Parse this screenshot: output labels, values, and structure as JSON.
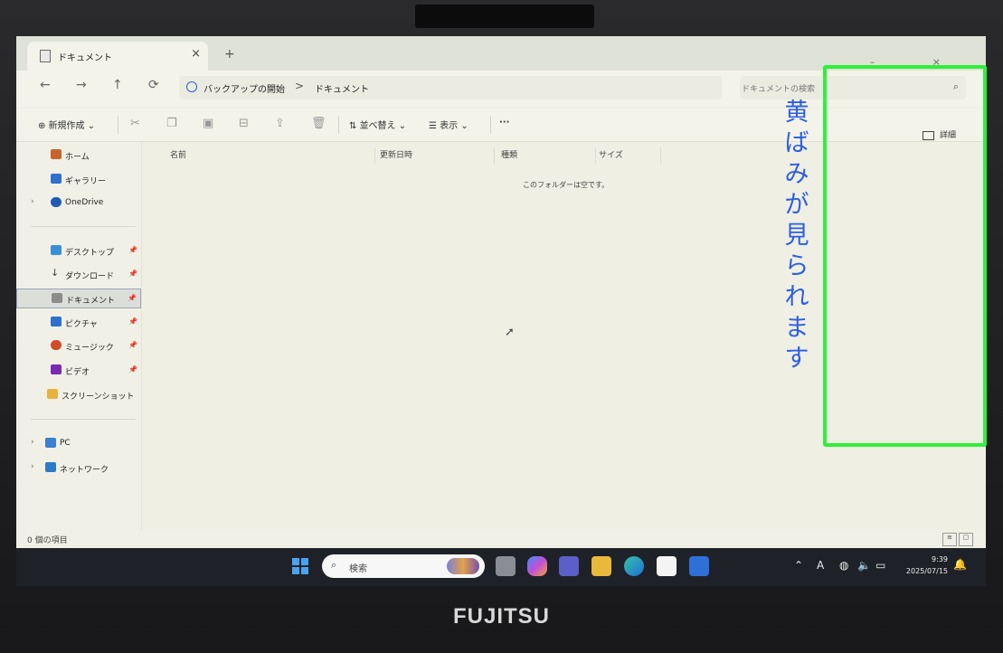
{
  "tab": {
    "title": "ドキュメント",
    "close": "×",
    "new": "+"
  },
  "window": {
    "controls": "– ×"
  },
  "nav": {
    "back": "←",
    "forward": "→",
    "up": "↑",
    "refresh": "⟳"
  },
  "address": {
    "segment1": "バックアップの開始",
    "separator": ">",
    "segment2": "ドキュメント"
  },
  "search": {
    "placeholder": "ドキュメントの検索",
    "icon": "⌕"
  },
  "toolbar": {
    "new_label": "新規作成",
    "sort_label": "並べ替え",
    "view_label": "表示",
    "more": "···",
    "details_label": "詳細"
  },
  "sidebar": {
    "items": [
      {
        "label": "ホーム",
        "icon": "home-icon"
      },
      {
        "label": "ギャラリー",
        "icon": "gallery-icon"
      },
      {
        "label": "OneDrive",
        "icon": "cloud-icon"
      },
      {
        "label": "デスクトップ",
        "icon": "desktop-icon"
      },
      {
        "label": "ダウンロード",
        "icon": "download-icon"
      },
      {
        "label": "ドキュメント",
        "icon": "document-icon",
        "selected": true
      },
      {
        "label": "ピクチャ",
        "icon": "picture-icon"
      },
      {
        "label": "ミュージック",
        "icon": "music-icon"
      },
      {
        "label": "ビデオ",
        "icon": "video-icon"
      },
      {
        "label": "スクリーンショット",
        "icon": "folder-icon"
      },
      {
        "label": "PC",
        "icon": "pc-icon"
      },
      {
        "label": "ネットワーク",
        "icon": "network-icon"
      }
    ]
  },
  "columns": {
    "name": "名前",
    "modified": "更新日時",
    "type": "種類",
    "size": "サイズ"
  },
  "content": {
    "empty_message": "このフォルダーは空です。"
  },
  "status": {
    "count": "0 個の項目"
  },
  "taskbar": {
    "search_label": "検索",
    "tray_ime": "A",
    "time": "9:39",
    "date": "2025/07/15"
  },
  "annotation": {
    "text": [
      "黄",
      "ば",
      "み",
      "が",
      "見",
      "ら",
      "れ",
      "ま",
      "す"
    ],
    "color": "#2b5ee8",
    "box_color": "#2ef03a"
  },
  "brand": "FUJITSU"
}
